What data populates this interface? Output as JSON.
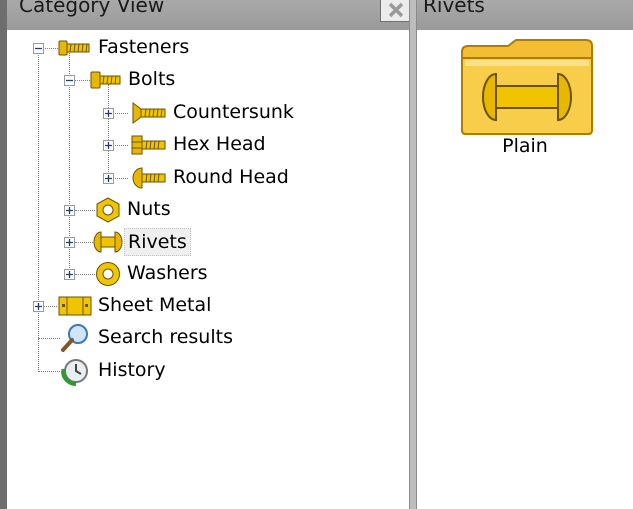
{
  "left_panel": {
    "title": "Category View",
    "tree": {
      "fasteners": "Fasteners",
      "bolts": "Bolts",
      "countersunk": "Countersunk",
      "hex_head": "Hex Head",
      "round_head": "Round Head",
      "nuts": "Nuts",
      "rivets": "Rivets",
      "washers": "Washers",
      "sheet_metal": "Sheet Metal",
      "search_results": "Search results",
      "history": "History"
    }
  },
  "right_panel": {
    "title": "Rivets",
    "items": [
      {
        "label": "Plain",
        "icon": "rivet-folder-icon"
      }
    ]
  },
  "colors": {
    "accent_gold": "#e8b800",
    "folder_yellow": "#f6c83a"
  }
}
